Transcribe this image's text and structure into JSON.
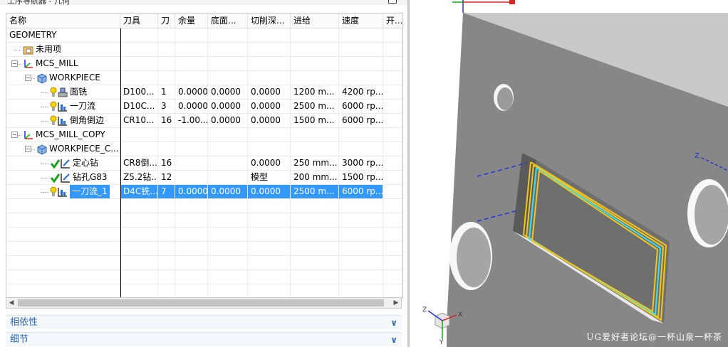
{
  "window": {
    "title": "工序导航器 - 几何"
  },
  "navigator": {
    "columns": [
      "名称",
      "刀具",
      "刀",
      "余量",
      "底面...",
      "切削深...",
      "进给",
      "速度",
      "开..."
    ],
    "rows": [
      {
        "name": "GEOMETRY",
        "cells": [
          "",
          "",
          "",
          "",
          "",
          "",
          "",
          ""
        ]
      },
      {
        "name": "未用项",
        "cells": [
          "",
          "",
          "",
          "",
          "",
          "",
          "",
          ""
        ]
      },
      {
        "name": "MCS_MILL",
        "cells": [
          "",
          "",
          "",
          "",
          "",
          "",
          "",
          ""
        ]
      },
      {
        "name": "WORKPIECE",
        "cells": [
          "",
          "",
          "",
          "",
          "",
          "",
          "",
          ""
        ]
      },
      {
        "name": "面铣",
        "cells": [
          "D100...",
          "1",
          "0.0000",
          "0.0000",
          "0.0000",
          "1200 m...",
          "4200 rp...",
          ""
        ]
      },
      {
        "name": "一刀流",
        "cells": [
          "D10C...",
          "3",
          "0.0000",
          "0.0000",
          "0.0000",
          "2500 m...",
          "6000 rp...",
          ""
        ]
      },
      {
        "name": "倒角倒边",
        "cells": [
          "CR10...",
          "16",
          "-1.00...",
          "0.0000",
          "0.0000",
          "1500 m...",
          "6000 rp...",
          ""
        ]
      },
      {
        "name": "MCS_MILL_COPY",
        "cells": [
          "",
          "",
          "",
          "",
          "",
          "",
          "",
          ""
        ]
      },
      {
        "name": "WORKPIECE_C...",
        "cells": [
          "",
          "",
          "",
          "",
          "",
          "",
          "",
          ""
        ]
      },
      {
        "name": "定心钻",
        "cells": [
          "CR8倒...",
          "16",
          "",
          "",
          "0.0000",
          "250 mm...",
          "3000 rp...",
          ""
        ]
      },
      {
        "name": "钻孔G83",
        "cells": [
          "Z5.2钻...",
          "12",
          "",
          "",
          "模型",
          "200 mm...",
          "1500 rp...",
          ""
        ]
      },
      {
        "name": "一刀流_1",
        "cells": [
          "D4C铣...",
          "7",
          "0.0000",
          "0.0000",
          "0.0000",
          "2500 m...",
          "6000 rp...",
          ""
        ]
      }
    ],
    "selected_row": "一刀流_1"
  },
  "panels": [
    {
      "label": "相依性",
      "icon": "chevron-down-icon"
    },
    {
      "label": "细节",
      "icon": "chevron-down-icon"
    }
  ],
  "viewport": {
    "watermark": "UG爱好者论坛@一杯山泉一杯茶",
    "triad_labels": {
      "x": "X",
      "y": "Y",
      "z": "Z"
    }
  },
  "colors": {
    "selection": "#3399ff",
    "panel_text": "#2e68b3",
    "part_top": "#c9c9c9",
    "part_face": "#878787",
    "toolpath_yellow": "#f5c518",
    "toolpath_cyan": "#33e0ff",
    "check_green": "#1aa31a"
  }
}
